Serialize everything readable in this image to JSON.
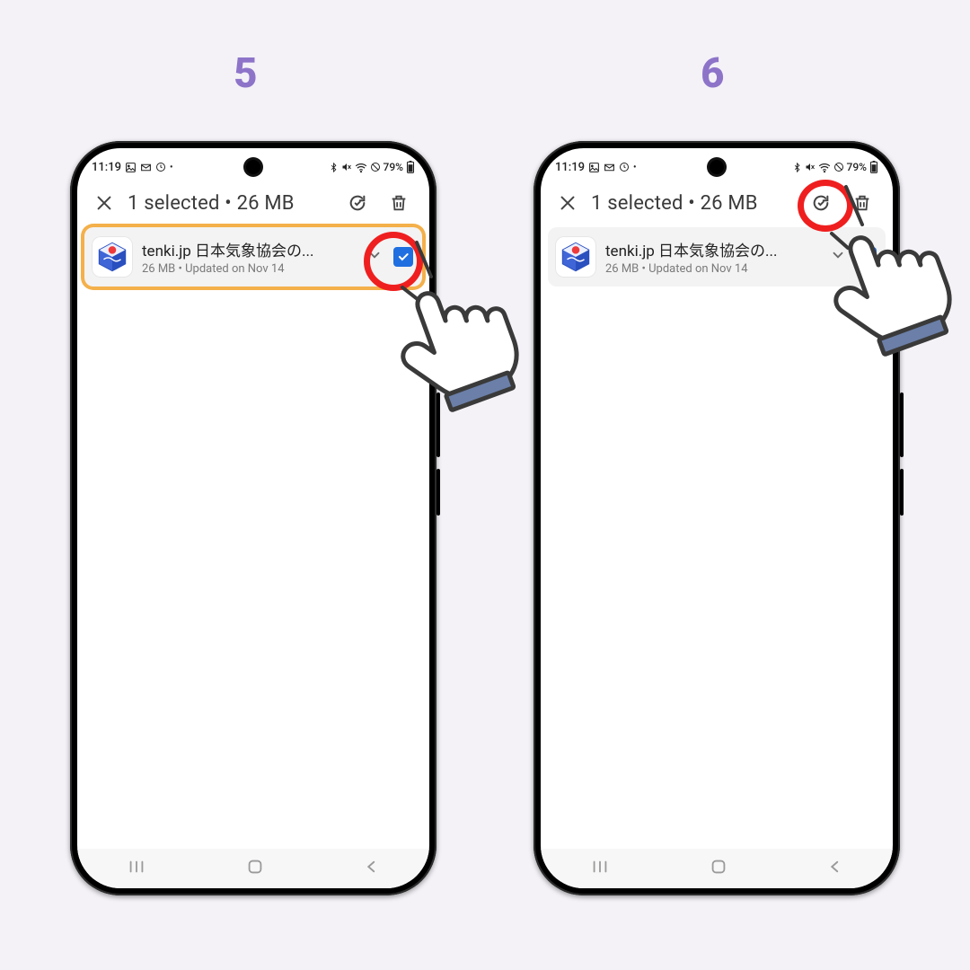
{
  "steps": {
    "left": {
      "number": "5"
    },
    "right": {
      "number": "6"
    }
  },
  "statusbar": {
    "time": "11:19",
    "battery_pct": "79%"
  },
  "header": {
    "title": "1 selected  •  26 MB"
  },
  "app": {
    "name": "tenki.jp 日本気象協会の...",
    "meta": "26 MB  •  Updated on Nov 14",
    "checked": true
  },
  "icons": {
    "close": "close-icon",
    "update": "update-check-icon",
    "trash": "trash-icon",
    "chevron": "chevron-down-icon",
    "checkbox": "checkbox-checked-icon",
    "nav_recent": "nav-recent-icon",
    "nav_home": "nav-home-icon",
    "nav_back": "nav-back-icon"
  }
}
